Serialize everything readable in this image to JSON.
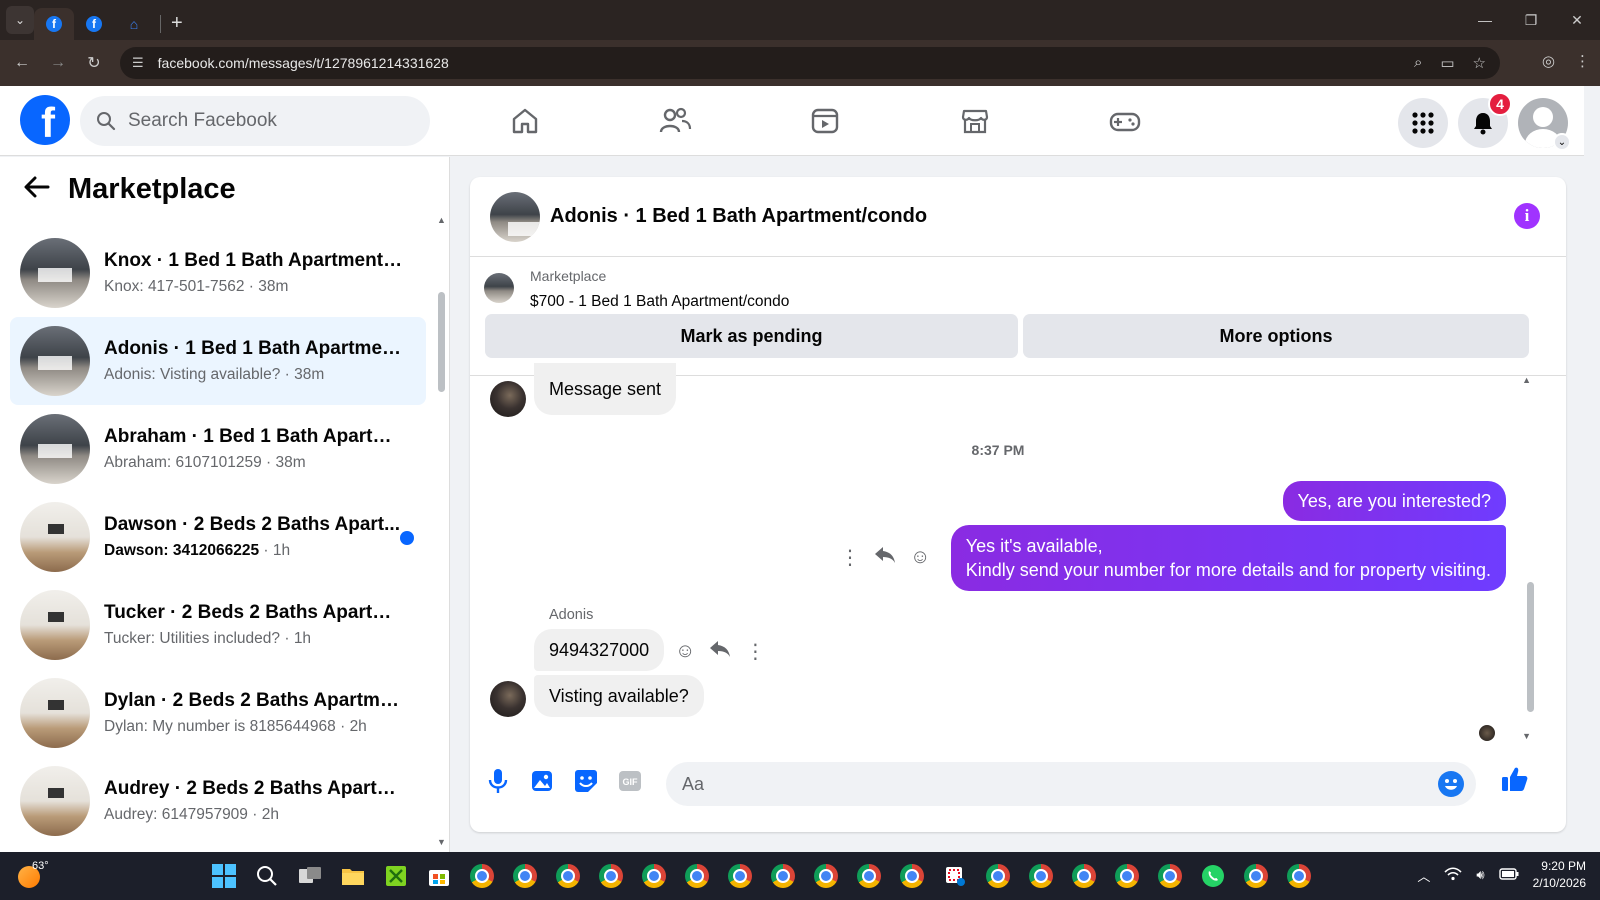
{
  "browser": {
    "url": "facebook.com/messages/t/1278961214331628",
    "new_tab": "+",
    "minimize": "—",
    "maximize": "❐",
    "close": "✕"
  },
  "header": {
    "logo": "f",
    "search_placeholder": "Search Facebook",
    "notification_count": "4"
  },
  "sidebar": {
    "title": "Marketplace",
    "conversations": [
      {
        "name": "Knox · 1 Bed 1 Bath Apartment/c...",
        "preview": "Knox: 417-501-7562",
        "time": "38m",
        "thumb": "dark",
        "unread": false,
        "active": false
      },
      {
        "name": "Adonis · 1 Bed 1 Bath Apartment...",
        "preview": "Adonis: Visting available?",
        "time": "38m",
        "thumb": "dark",
        "unread": false,
        "active": true
      },
      {
        "name": "Abraham · 1 Bed 1 Bath Apartme...",
        "preview": "Abraham: 6107101259",
        "time": "38m",
        "thumb": "dark",
        "unread": false,
        "active": false
      },
      {
        "name": "Dawson · 2 Beds 2 Baths Apart...",
        "preview": "Dawson: 3412066225",
        "time": "1h",
        "thumb": "light",
        "unread": true,
        "active": false
      },
      {
        "name": "Tucker · 2 Beds 2 Baths Apartme...",
        "preview": "Tucker: Utilities included?",
        "time": "1h",
        "thumb": "light",
        "unread": false,
        "active": false
      },
      {
        "name": "Dylan · 2 Beds 2 Baths Apartmen...",
        "preview": "Dylan: My number is 8185644968",
        "time": "2h",
        "thumb": "light",
        "unread": false,
        "active": false
      },
      {
        "name": "Audrey · 2 Beds 2 Baths Apartme...",
        "preview": "Audrey: 6147957909",
        "time": "2h",
        "thumb": "light",
        "unread": false,
        "active": false
      }
    ]
  },
  "chat": {
    "title": "Adonis · 1 Bed 1 Bath Apartment/condo",
    "marketplace_label": "Marketplace",
    "listing": "$700 - 1 Bed 1 Bath Apartment/condo",
    "mark_pending": "Mark as pending",
    "more_options": "More options",
    "msg_sent": "Message sent",
    "timestamp": "8:37 PM",
    "out_1": "Yes, are you interested?",
    "out_2_line1": "Yes it's available,",
    "out_2_line2": "Kindly send your number for more details and for property visiting.",
    "sender_name": "Adonis",
    "in_1": "9494327000",
    "in_2": "Visting available?",
    "composer_placeholder": "Aa"
  },
  "taskbar": {
    "temperature": "63°",
    "time": "9:20 PM",
    "date": "2/10/2026"
  },
  "colors": {
    "fb_blue": "#0866ff",
    "outgoing_bubble": "#7b2ff7",
    "badge_red": "#e41e3f",
    "active_row": "#ebf5ff"
  }
}
